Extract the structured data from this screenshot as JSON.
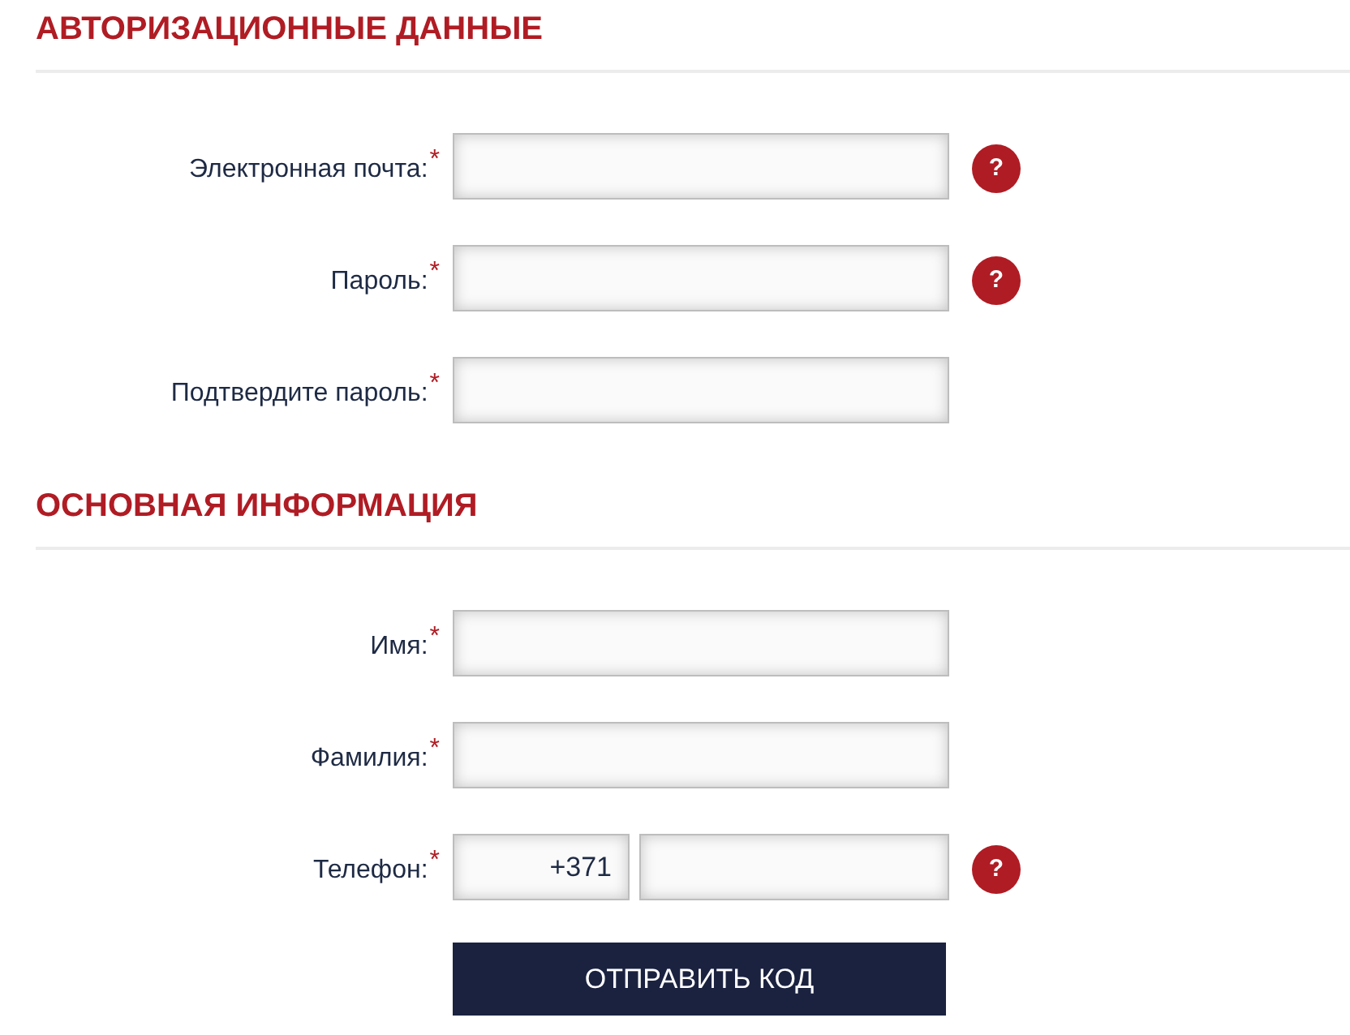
{
  "sections": [
    {
      "title": "АВТОРИЗАЦИОННЫЕ ДАННЫЕ",
      "fields": [
        {
          "label": "Электронная почта:",
          "required_mark": "*",
          "help": "?"
        },
        {
          "label": "Пароль:",
          "required_mark": "*",
          "help": "?"
        },
        {
          "label": "Подтвердите пароль:",
          "required_mark": "*"
        }
      ]
    },
    {
      "title": "ОСНОВНАЯ ИНФОРМАЦИЯ",
      "fields": [
        {
          "label": "Имя:",
          "required_mark": "*"
        },
        {
          "label": "Фамилия:",
          "required_mark": "*"
        },
        {
          "label": "Телефон:",
          "required_mark": "*",
          "prefix": "+371",
          "help": "?"
        }
      ]
    }
  ],
  "submit_button": {
    "label": "ОТПРАВИТЬ КОД"
  }
}
